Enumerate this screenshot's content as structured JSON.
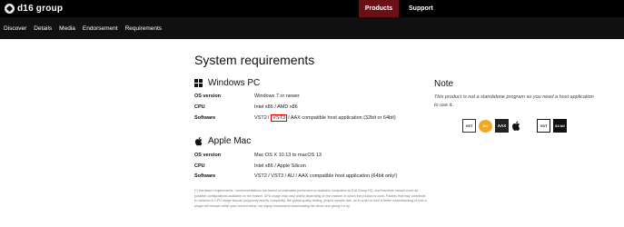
{
  "brand": {
    "name": "d16 group"
  },
  "topnav": [
    {
      "label": "Products",
      "active": true
    },
    {
      "label": "Support",
      "active": false
    }
  ],
  "subnav": [
    "Discover",
    "Details",
    "Media",
    "Endorsement",
    "Requirements"
  ],
  "main": {
    "title": "System requirements",
    "windows": {
      "heading": "Windows PC",
      "rows": [
        {
          "label": "OS version",
          "value": "Windows 7 or newer"
        },
        {
          "label": "CPU",
          "value": "Intel x86 / AMD x86"
        }
      ],
      "software": {
        "label": "Software",
        "vst2": "VST2",
        "slash": "/",
        "vst3": "VST3",
        "rest": "/ AAX compatible host application (32bit or 64bit)"
      }
    },
    "mac": {
      "heading": "Apple Mac",
      "rows": [
        {
          "label": "OS version",
          "value": "Mac OS X 10.13 to macOS 13"
        },
        {
          "label": "CPU",
          "value": "Intel x86 / Apple Silicon"
        },
        {
          "label": "Software",
          "value": "VST2 / VST3 / AU / AAX compatible host application (64bit only!)"
        }
      ]
    },
    "footnote": "(*) Hardware requirements / recommendations are based on estimates performed on available computers at D16 Group HQ, and therefore cannot cover all possible configurations available on the market. CPU usage may vary widely depending on the manner in which the product is used. Factors that may contribute to variance in CPU usage include polyphony and its complexity, the global quality setting, project sample rate, so in order to form a better understanding of how a plugin will behave within your current setup, we highly recommend downloading the demo and giving it a try."
  },
  "note": {
    "title": "Note",
    "text": "This product is not a standalone program so you need a host application to use it."
  },
  "format_icons": [
    {
      "name": "vst-icon",
      "label": "VST"
    },
    {
      "name": "au-icon",
      "label": "AU"
    },
    {
      "name": "aax-icon",
      "label": "AAX"
    },
    {
      "name": "apple-icon",
      "label": ""
    },
    {
      "name": "windows-icon",
      "label": ""
    },
    {
      "name": "vst3-icon",
      "label": "VST"
    },
    {
      "name": "bit-icon",
      "label": "64 bit"
    }
  ]
}
